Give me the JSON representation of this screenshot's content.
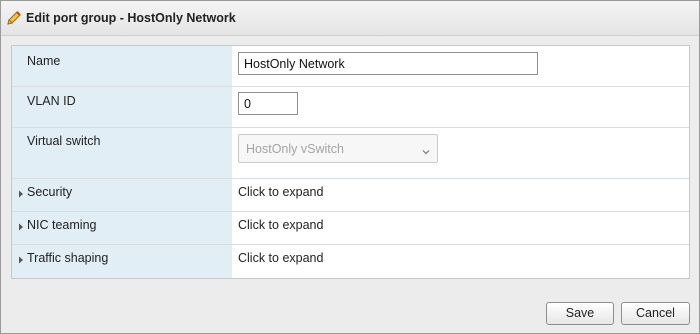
{
  "dialog": {
    "title": "Edit port group - HostOnly Network",
    "title_icon": "pencil-icon"
  },
  "fields": {
    "name": {
      "label": "Name",
      "value": "HostOnly Network"
    },
    "vlan": {
      "label": "VLAN ID",
      "value": "0"
    },
    "vswitch": {
      "label": "Virtual switch",
      "value": "HostOnly vSwitch",
      "disabled": true
    }
  },
  "expandables": [
    {
      "label": "Security",
      "value": "Click to expand"
    },
    {
      "label": "NIC teaming",
      "value": "Click to expand"
    },
    {
      "label": "Traffic shaping",
      "value": "Click to expand"
    }
  ],
  "buttons": {
    "save": "Save",
    "cancel": "Cancel"
  },
  "colors": {
    "label_bg": "#e2eef6",
    "dialog_bg": "#ececec",
    "disabled_text": "#a4a4a4"
  }
}
